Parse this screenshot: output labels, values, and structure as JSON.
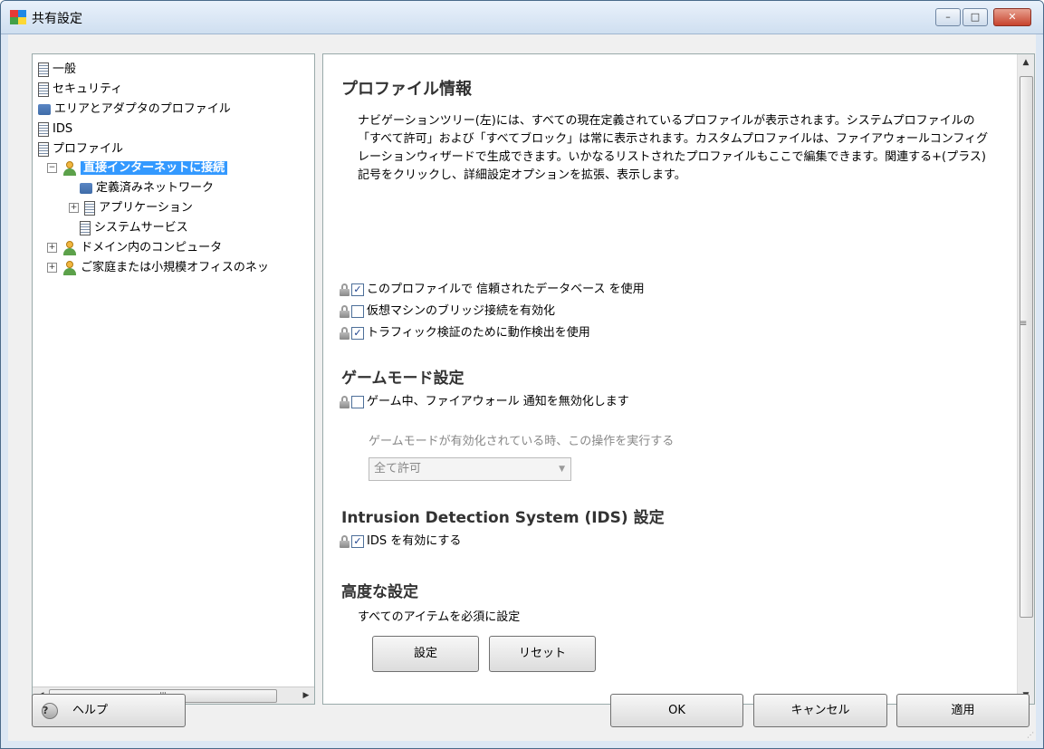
{
  "window": {
    "title": "共有設定",
    "minimize_glyph": "–",
    "maximize_glyph": "□",
    "close_glyph": "✕"
  },
  "tree": {
    "items": [
      {
        "label": "一般",
        "icon": "doc-icon"
      },
      {
        "label": "セキュリティ",
        "icon": "doc-icon"
      },
      {
        "label": "エリアとアダプタのプロファイル",
        "icon": "network-icon"
      },
      {
        "label": "IDS",
        "icon": "doc-icon"
      },
      {
        "label": "プロファイル",
        "icon": "doc-icon"
      },
      {
        "label": "直接インターネットに接続",
        "icon": "person-icon",
        "selected": true,
        "expander": "−"
      },
      {
        "label": "定義済みネットワーク",
        "icon": "network-icon"
      },
      {
        "label": "アプリケーション",
        "icon": "doc-icon",
        "expander": "+"
      },
      {
        "label": "システムサービス",
        "icon": "doc-icon"
      },
      {
        "label": "ドメイン内のコンピュータ",
        "icon": "person-icon",
        "expander": "+"
      },
      {
        "label": "ご家庭または小規模オフィスのネッ",
        "icon": "person-icon",
        "expander": "+"
      }
    ],
    "scroll_left": "◀",
    "scroll_right": "▶",
    "scroll_grip": "III"
  },
  "content": {
    "heading": "プロファイル情報",
    "description": "ナビゲーションツリー(左)には、すべての現在定義されているプロファイルが表示されます。システムプロファイルの「すべて許可」および「すべてブロック」は常に表示されます。カスタムプロファイルは、ファイアウォールコンフィグレーションウィザードで生成できます。いかなるリストされたプロファイルもここで編集できます。関連する+(プラス)記号をクリックし、詳細設定オプションを拡張、表示します。",
    "options": [
      {
        "label": "このプロファイルで 信頼されたデータベース を使用",
        "checked": true
      },
      {
        "label": "仮想マシンのブリッジ接続を有効化",
        "checked": false
      },
      {
        "label": "トラフィック検証のために動作検出を使用",
        "checked": true
      }
    ],
    "game_mode": {
      "heading": "ゲームモード設定",
      "option": {
        "label": "ゲーム中、ファイアウォール 通知を無効化します",
        "checked": false
      },
      "sub_label": "ゲームモードが有効化されている時、この操作を実行する",
      "select_value": "全て許可"
    },
    "ids": {
      "heading": "Intrusion Detection System (IDS) 設定",
      "option": {
        "label": "IDS を有効にする",
        "checked": true
      }
    },
    "advanced": {
      "heading": "高度な設定",
      "text": "すべてのアイテムを必須に設定",
      "settings_button": "設定",
      "reset_button": "リセット"
    },
    "scroll_up": "▲",
    "scroll_down": "▼",
    "scroll_grip": "≡"
  },
  "footer": {
    "help_button": "ヘルプ",
    "help_glyph": "?",
    "ok_button": "OK",
    "cancel_button": "キャンセル",
    "apply_button": "適用"
  },
  "colors": {
    "selection": "#3399ff",
    "window_frame": "#dce7f4",
    "dialog_bg": "#f0f0f0",
    "close_button": "#c7432d"
  }
}
